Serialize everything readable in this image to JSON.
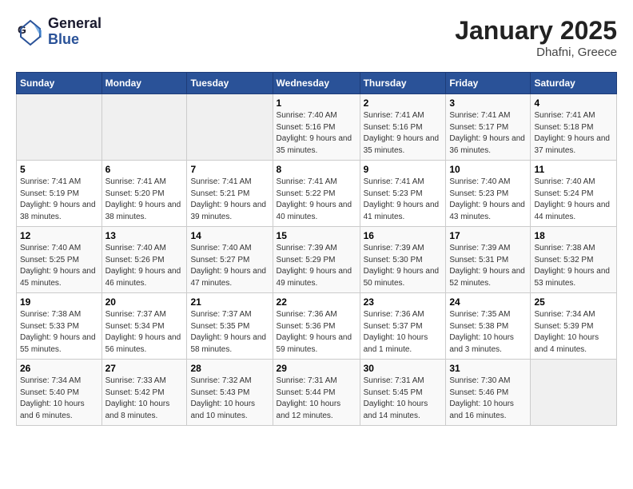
{
  "header": {
    "logo_general": "General",
    "logo_blue": "Blue",
    "month_title": "January 2025",
    "location": "Dhafni, Greece"
  },
  "days_of_week": [
    "Sunday",
    "Monday",
    "Tuesday",
    "Wednesday",
    "Thursday",
    "Friday",
    "Saturday"
  ],
  "weeks": [
    [
      {
        "day": "",
        "info": ""
      },
      {
        "day": "",
        "info": ""
      },
      {
        "day": "",
        "info": ""
      },
      {
        "day": "1",
        "info": "Sunrise: 7:40 AM\nSunset: 5:16 PM\nDaylight: 9 hours and 35 minutes."
      },
      {
        "day": "2",
        "info": "Sunrise: 7:41 AM\nSunset: 5:16 PM\nDaylight: 9 hours and 35 minutes."
      },
      {
        "day": "3",
        "info": "Sunrise: 7:41 AM\nSunset: 5:17 PM\nDaylight: 9 hours and 36 minutes."
      },
      {
        "day": "4",
        "info": "Sunrise: 7:41 AM\nSunset: 5:18 PM\nDaylight: 9 hours and 37 minutes."
      }
    ],
    [
      {
        "day": "5",
        "info": "Sunrise: 7:41 AM\nSunset: 5:19 PM\nDaylight: 9 hours and 38 minutes."
      },
      {
        "day": "6",
        "info": "Sunrise: 7:41 AM\nSunset: 5:20 PM\nDaylight: 9 hours and 38 minutes."
      },
      {
        "day": "7",
        "info": "Sunrise: 7:41 AM\nSunset: 5:21 PM\nDaylight: 9 hours and 39 minutes."
      },
      {
        "day": "8",
        "info": "Sunrise: 7:41 AM\nSunset: 5:22 PM\nDaylight: 9 hours and 40 minutes."
      },
      {
        "day": "9",
        "info": "Sunrise: 7:41 AM\nSunset: 5:23 PM\nDaylight: 9 hours and 41 minutes."
      },
      {
        "day": "10",
        "info": "Sunrise: 7:40 AM\nSunset: 5:23 PM\nDaylight: 9 hours and 43 minutes."
      },
      {
        "day": "11",
        "info": "Sunrise: 7:40 AM\nSunset: 5:24 PM\nDaylight: 9 hours and 44 minutes."
      }
    ],
    [
      {
        "day": "12",
        "info": "Sunrise: 7:40 AM\nSunset: 5:25 PM\nDaylight: 9 hours and 45 minutes."
      },
      {
        "day": "13",
        "info": "Sunrise: 7:40 AM\nSunset: 5:26 PM\nDaylight: 9 hours and 46 minutes."
      },
      {
        "day": "14",
        "info": "Sunrise: 7:40 AM\nSunset: 5:27 PM\nDaylight: 9 hours and 47 minutes."
      },
      {
        "day": "15",
        "info": "Sunrise: 7:39 AM\nSunset: 5:29 PM\nDaylight: 9 hours and 49 minutes."
      },
      {
        "day": "16",
        "info": "Sunrise: 7:39 AM\nSunset: 5:30 PM\nDaylight: 9 hours and 50 minutes."
      },
      {
        "day": "17",
        "info": "Sunrise: 7:39 AM\nSunset: 5:31 PM\nDaylight: 9 hours and 52 minutes."
      },
      {
        "day": "18",
        "info": "Sunrise: 7:38 AM\nSunset: 5:32 PM\nDaylight: 9 hours and 53 minutes."
      }
    ],
    [
      {
        "day": "19",
        "info": "Sunrise: 7:38 AM\nSunset: 5:33 PM\nDaylight: 9 hours and 55 minutes."
      },
      {
        "day": "20",
        "info": "Sunrise: 7:37 AM\nSunset: 5:34 PM\nDaylight: 9 hours and 56 minutes."
      },
      {
        "day": "21",
        "info": "Sunrise: 7:37 AM\nSunset: 5:35 PM\nDaylight: 9 hours and 58 minutes."
      },
      {
        "day": "22",
        "info": "Sunrise: 7:36 AM\nSunset: 5:36 PM\nDaylight: 9 hours and 59 minutes."
      },
      {
        "day": "23",
        "info": "Sunrise: 7:36 AM\nSunset: 5:37 PM\nDaylight: 10 hours and 1 minute."
      },
      {
        "day": "24",
        "info": "Sunrise: 7:35 AM\nSunset: 5:38 PM\nDaylight: 10 hours and 3 minutes."
      },
      {
        "day": "25",
        "info": "Sunrise: 7:34 AM\nSunset: 5:39 PM\nDaylight: 10 hours and 4 minutes."
      }
    ],
    [
      {
        "day": "26",
        "info": "Sunrise: 7:34 AM\nSunset: 5:40 PM\nDaylight: 10 hours and 6 minutes."
      },
      {
        "day": "27",
        "info": "Sunrise: 7:33 AM\nSunset: 5:42 PM\nDaylight: 10 hours and 8 minutes."
      },
      {
        "day": "28",
        "info": "Sunrise: 7:32 AM\nSunset: 5:43 PM\nDaylight: 10 hours and 10 minutes."
      },
      {
        "day": "29",
        "info": "Sunrise: 7:31 AM\nSunset: 5:44 PM\nDaylight: 10 hours and 12 minutes."
      },
      {
        "day": "30",
        "info": "Sunrise: 7:31 AM\nSunset: 5:45 PM\nDaylight: 10 hours and 14 minutes."
      },
      {
        "day": "31",
        "info": "Sunrise: 7:30 AM\nSunset: 5:46 PM\nDaylight: 10 hours and 16 minutes."
      },
      {
        "day": "",
        "info": ""
      }
    ]
  ]
}
